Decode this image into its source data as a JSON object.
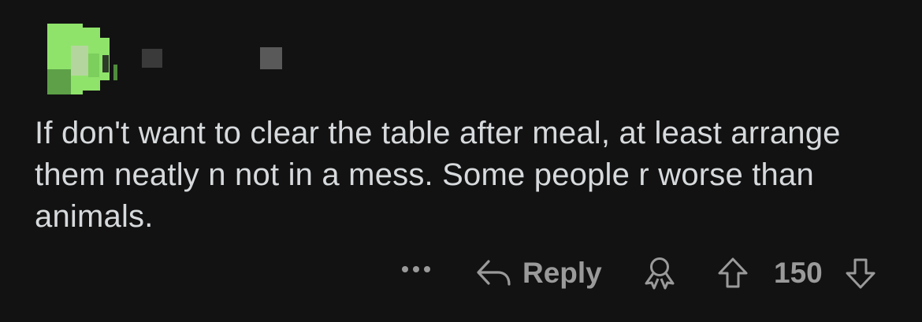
{
  "comment": {
    "body": "If don't want to clear the table after meal, at least arrange them neatly n not in a mess. Some people r worse than animals."
  },
  "actions": {
    "reply_label": "Reply",
    "score": "150"
  },
  "colors": {
    "background": "#121212",
    "text": "#d7dadc",
    "action_gray": "#9a9a9a",
    "avatar_green": "#8fe36a"
  },
  "icons": {
    "more": "more-icon",
    "reply": "reply-arrow-icon",
    "award": "award-icon",
    "upvote": "upvote-arrow-icon",
    "downvote": "downvote-arrow-icon"
  }
}
